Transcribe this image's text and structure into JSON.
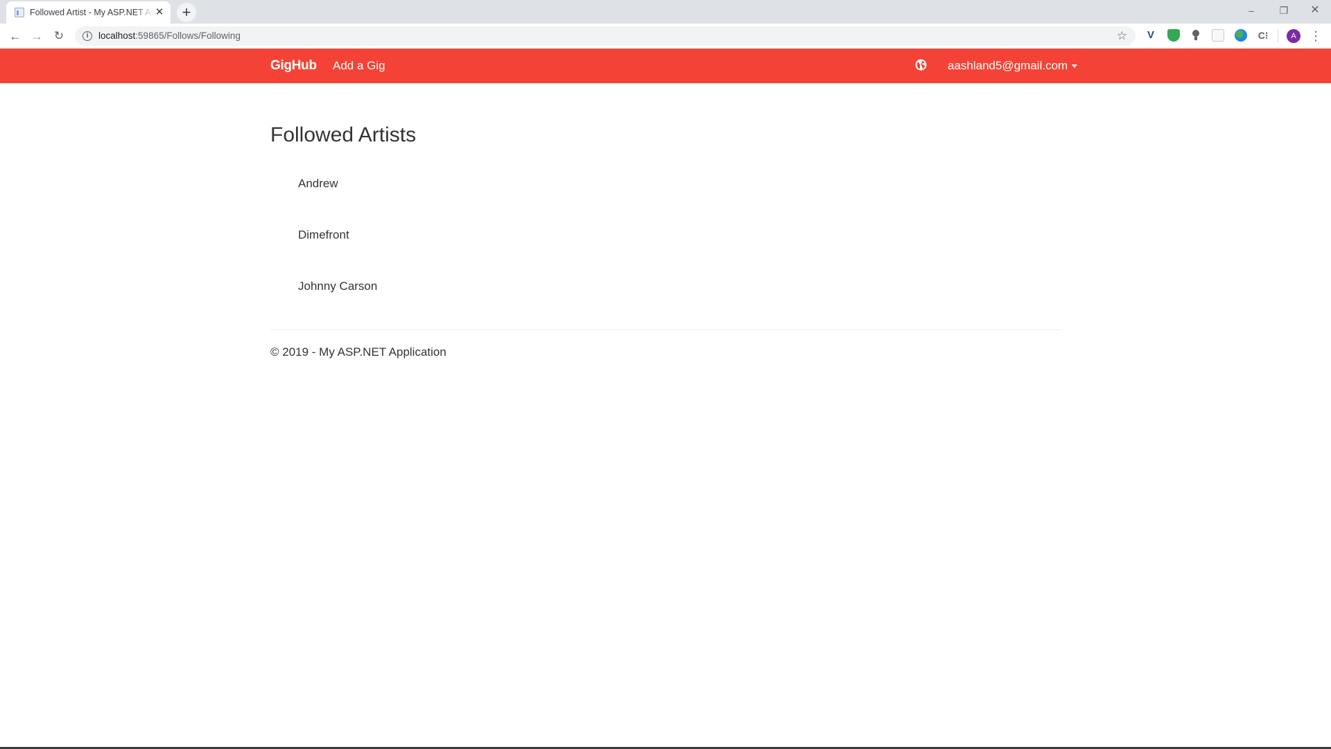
{
  "browser": {
    "tab_title": "Followed Artist - My ASP.NET Application",
    "new_tab_symbol": "+",
    "url_host": "localhost",
    "url_rest": ":59865/Follows/Following",
    "window_controls": {
      "minimize": "–",
      "restore": "❐",
      "close": "✕"
    },
    "profile_initial": "A",
    "extension_icons": [
      "vimium-icon",
      "shield-icon",
      "lightbulb-icon",
      "blank-extension-icon",
      "globe-extension-icon",
      "c-extension-icon"
    ]
  },
  "navbar": {
    "brand": "GigHub",
    "add_gig": "Add a Gig",
    "user_email": "aashland5@gmail.com",
    "color": "#f44336"
  },
  "main": {
    "title": "Followed Artists",
    "artists": [
      "Andrew",
      "Dimefront",
      "Johnny Carson"
    ]
  },
  "footer": {
    "text": "© 2019 - My ASP.NET Application"
  }
}
